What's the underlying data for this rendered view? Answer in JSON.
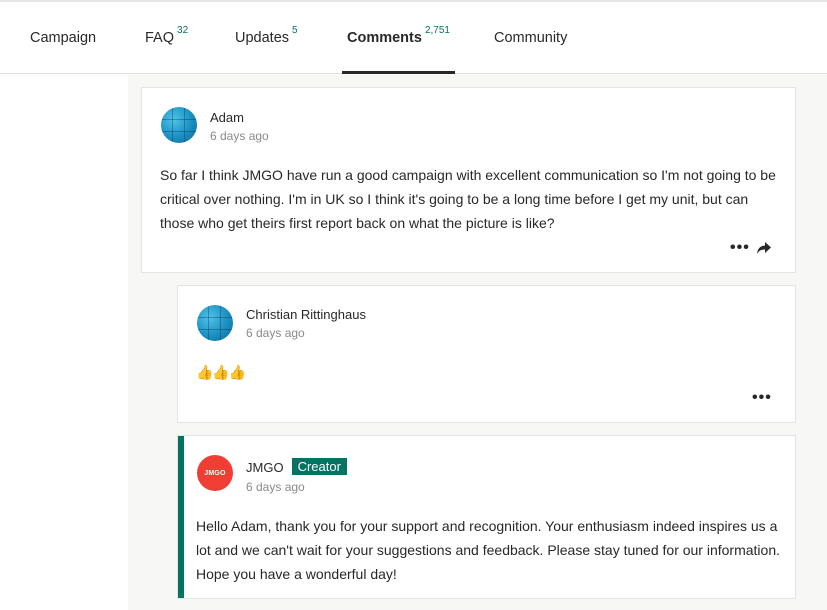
{
  "nav": {
    "tabs": [
      {
        "label": "Campaign",
        "count": ""
      },
      {
        "label": "FAQ",
        "count": "32"
      },
      {
        "label": "Updates",
        "count": "5"
      },
      {
        "label": "Comments",
        "count": "2,751"
      },
      {
        "label": "Community",
        "count": ""
      }
    ],
    "active_tab": "Comments"
  },
  "comments": {
    "main": {
      "author": "Adam",
      "time": "6 days ago",
      "text": "So far I think JMGO have run a good campaign with excellent communication so I'm not going to be critical over nothing. I'm in UK so I think it's going to be a long time before I get my unit, but can those who get theirs first report back on what the picture is like?",
      "more_label": "•••"
    },
    "reply1": {
      "author": "Christian Rittinghaus",
      "time": "6 days ago",
      "text": "👍👍👍",
      "more_label": "•••"
    },
    "reply2": {
      "author": "JMGO",
      "badge": "Creator",
      "avatar_text": "JMGO",
      "time": "6 days ago",
      "text": "Hello Adam, thank you for your support and recognition. Your enthusiasm indeed inspires us a lot and we can't wait for your suggestions and feedback. Please stay tuned for our information. Hope you have a wonderful day!"
    }
  },
  "colors": {
    "accent": "#037362",
    "creator_avatar": "#f03e35"
  }
}
